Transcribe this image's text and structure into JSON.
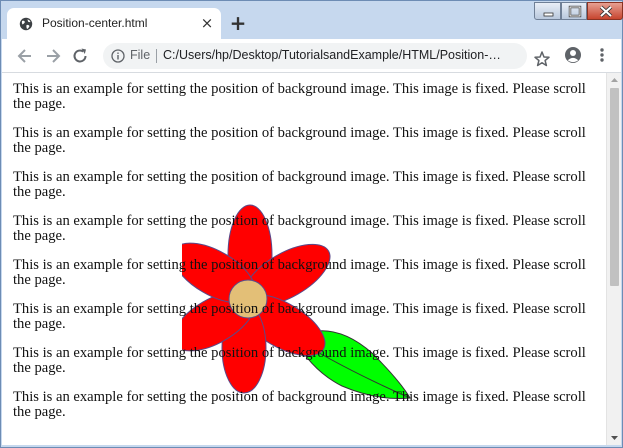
{
  "tab": {
    "title": "Position-center.html",
    "close_glyph": "×",
    "favicon": "globe-icon"
  },
  "new_tab_glyph": "+",
  "window_controls": [
    "minimize-icon",
    "maximize-icon",
    "close-icon"
  ],
  "toolbar": {
    "back": "back-arrow-icon",
    "forward": "forward-arrow-icon",
    "reload": "reload-icon",
    "scheme_label": "File",
    "url": "C:/Users/hp/Desktop/TutorialsandExample/HTML/Position-center.html",
    "bookmark": "star-icon",
    "profile": "account-icon",
    "menu": "three-dot-menu-icon"
  },
  "page": {
    "paragraphs": [
      "This is an example for setting the position of background image. This image is fixed. Please scroll the page.",
      "This is an example for setting the position of background image. This image is fixed. Please scroll the page.",
      "This is an example for setting the position of background image. This image is fixed. Please scroll the page.",
      "This is an example for setting the position of background image. This image is fixed. Please scroll the page.",
      "This is an example for setting the position of background image. This image is fixed. Please scroll the page.",
      "This is an example for setting the position of background image. This image is fixed. Please scroll the page.",
      "This is an example for setting the position of background image. This image is fixed. Please scroll the page.",
      "This is an example for setting the position of background image. This image is fixed. Please scroll the page."
    ],
    "background_image": "flower-illustration",
    "colors": {
      "petal": "#ff0000",
      "petal_outline": "#5a4a8a",
      "center": "#e3bf77",
      "leaf": "#00ff00"
    }
  }
}
